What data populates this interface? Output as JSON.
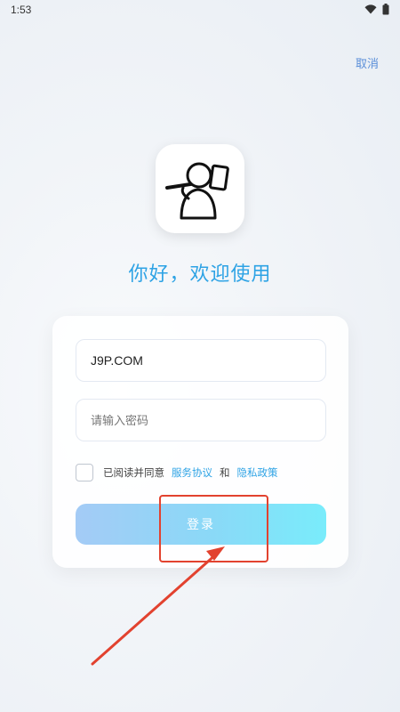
{
  "status_bar": {
    "time": "1:53"
  },
  "header": {
    "cancel_label": "取消"
  },
  "welcome_text": "你好，欢迎使用",
  "form": {
    "username_value": "J9P.COM",
    "password_placeholder": "请输入密码",
    "agreement": {
      "checked": false,
      "prefix": "已阅读并同意",
      "terms_link": "服务协议",
      "and": "和",
      "privacy_link": "隐私政策"
    },
    "login_label": "登录"
  },
  "colors": {
    "accent": "#2ea3e5",
    "cancel_link": "#5b8fd9",
    "button_gradient_start": "#a4cbf6",
    "button_gradient_end": "#79ecfb",
    "annotation": "#e2422f"
  },
  "icons": {
    "app_logo": "worker-with-hammer-logo",
    "wifi": "wifi-icon",
    "battery": "battery-icon"
  }
}
